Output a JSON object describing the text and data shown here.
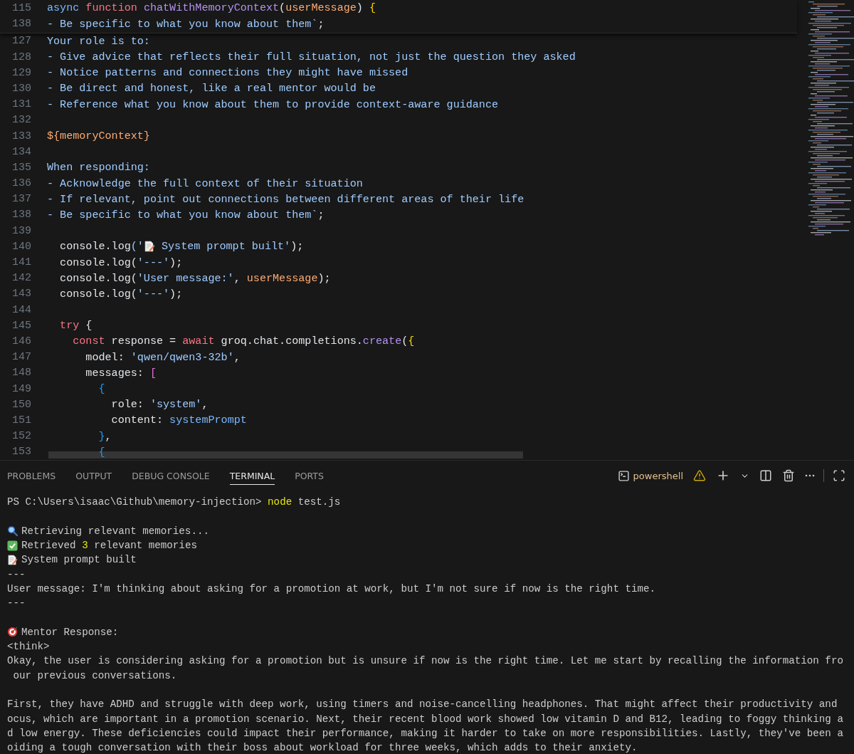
{
  "editor": {
    "sticky_lines": [
      {
        "number": "115",
        "tokens": [
          {
            "text": "async",
            "kind": "storage"
          },
          {
            "text": " function",
            "kind": "keyword"
          },
          {
            "text": " chatWithMemoryContext",
            "kind": "func"
          },
          {
            "text": "(",
            "kind": "plain"
          },
          {
            "text": "userMessage",
            "kind": "param"
          },
          {
            "text": ") ",
            "kind": "plain"
          },
          {
            "text": "{",
            "kind": "brace"
          }
        ]
      },
      {
        "number": "138",
        "tokens": [
          {
            "text": "- Be specific to what you know about them`",
            "kind": "string"
          },
          {
            "text": ";",
            "kind": "plain"
          }
        ]
      }
    ],
    "lines": [
      {
        "number": "127",
        "tokens": [
          {
            "text": "Your role is to:",
            "kind": "string"
          }
        ]
      },
      {
        "number": "128",
        "tokens": [
          {
            "text": "- Give advice that reflects their full situation, not just the question they asked",
            "kind": "string"
          }
        ]
      },
      {
        "number": "129",
        "tokens": [
          {
            "text": "- Notice patterns and connections they might have missed",
            "kind": "string"
          }
        ]
      },
      {
        "number": "130",
        "tokens": [
          {
            "text": "- Be direct and honest, like a real mentor would be",
            "kind": "string"
          }
        ]
      },
      {
        "number": "131",
        "tokens": [
          {
            "text": "- Reference what you know about them to provide context-aware guidance",
            "kind": "string"
          }
        ]
      },
      {
        "number": "132"
      },
      {
        "number": "133",
        "tokens": [
          {
            "text": "${memoryContext}",
            "kind": "param"
          }
        ]
      },
      {
        "number": "134"
      },
      {
        "number": "135",
        "tokens": [
          {
            "text": "When responding:",
            "kind": "string"
          }
        ]
      },
      {
        "number": "136",
        "tokens": [
          {
            "text": "- Acknowledge the full context of their situation",
            "kind": "string"
          }
        ]
      },
      {
        "number": "137",
        "tokens": [
          {
            "text": "- If relevant, point out connections between different areas of their life",
            "kind": "string"
          }
        ]
      },
      {
        "number": "138",
        "tokens": [
          {
            "text": "- Be specific to what you know about them`",
            "kind": "string"
          },
          {
            "text": ";",
            "kind": "plain"
          }
        ]
      },
      {
        "number": "139"
      },
      {
        "number": "140",
        "tokens": [
          {
            "text": "  console",
            "kind": "plain"
          },
          {
            "text": ".",
            "kind": "plain"
          },
          {
            "text": "log",
            "kind": "plain"
          },
          {
            "text": "('",
            "kind": "string"
          },
          {
            "kind": "memo"
          },
          {
            "text": " System prompt built'",
            "kind": "string"
          },
          {
            "text": ");",
            "kind": "plain"
          }
        ]
      },
      {
        "number": "141",
        "tokens": [
          {
            "text": "  console.log(",
            "kind": "plain"
          },
          {
            "text": "'---'",
            "kind": "string"
          },
          {
            "text": ");",
            "kind": "plain"
          }
        ]
      },
      {
        "number": "142",
        "tokens": [
          {
            "text": "  console.log(",
            "kind": "plain"
          },
          {
            "text": "'User message:'",
            "kind": "string"
          },
          {
            "text": ", ",
            "kind": "plain"
          },
          {
            "text": "userMessage",
            "kind": "param"
          },
          {
            "text": ");",
            "kind": "plain"
          }
        ]
      },
      {
        "number": "143",
        "tokens": [
          {
            "text": "  console.log(",
            "kind": "plain"
          },
          {
            "text": "'---'",
            "kind": "string"
          },
          {
            "text": ");",
            "kind": "plain"
          }
        ]
      },
      {
        "number": "144"
      },
      {
        "number": "145",
        "tokens": [
          {
            "text": "  try",
            "kind": "keyword"
          },
          {
            "text": " {",
            "kind": "plain"
          }
        ]
      },
      {
        "number": "146",
        "tokens": [
          {
            "text": "    const",
            "kind": "keyword"
          },
          {
            "text": " response = ",
            "kind": "plain"
          },
          {
            "text": "await",
            "kind": "keyword"
          },
          {
            "text": " groq.chat.completions.",
            "kind": "plain"
          },
          {
            "text": "create",
            "kind": "func"
          },
          {
            "text": "(",
            "kind": "plain"
          },
          {
            "text": "{",
            "kind": "brace"
          }
        ]
      },
      {
        "number": "147",
        "tokens": [
          {
            "text": "      model: ",
            "kind": "plain"
          },
          {
            "text": "'qwen/qwen3-32b'",
            "kind": "string"
          },
          {
            "text": ",",
            "kind": "plain"
          }
        ]
      },
      {
        "number": "148",
        "tokens": [
          {
            "text": "      messages: ",
            "kind": "plain"
          },
          {
            "text": "[",
            "kind": "bracket"
          }
        ]
      },
      {
        "number": "149",
        "tokens": [
          {
            "text": "        {",
            "kind": "brace2"
          }
        ]
      },
      {
        "number": "150",
        "tokens": [
          {
            "text": "          role: ",
            "kind": "plain"
          },
          {
            "text": "'system'",
            "kind": "string"
          },
          {
            "text": ",",
            "kind": "plain"
          }
        ]
      },
      {
        "number": "151",
        "tokens": [
          {
            "text": "          content: ",
            "kind": "plain"
          },
          {
            "text": "systemPrompt",
            "kind": "storage"
          }
        ]
      },
      {
        "number": "152",
        "tokens": [
          {
            "text": "        }",
            "kind": "brace2"
          },
          {
            "text": ",",
            "kind": "plain"
          }
        ]
      },
      {
        "number": "153",
        "tokens": [
          {
            "text": "        {",
            "kind": "brace2"
          }
        ]
      }
    ]
  },
  "panel": {
    "tabs": [
      {
        "label": "PROBLEMS",
        "selected": false
      },
      {
        "label": "OUTPUT",
        "selected": false
      },
      {
        "label": "DEBUG CONSOLE",
        "selected": false
      },
      {
        "label": "TERMINAL",
        "selected": true
      },
      {
        "label": "PORTS",
        "selected": false
      }
    ],
    "shell": "powershell"
  },
  "terminal": {
    "rows": [
      {
        "kind": "text",
        "segments": [
          {
            "text": "PS C:\\Users\\isaac\\Github\\memory-injection> ",
            "kind": "plain"
          },
          {
            "text": "node",
            "kind": "command"
          },
          {
            "text": " test.js",
            "kind": "plain"
          }
        ]
      },
      {
        "kind": "blank"
      },
      {
        "kind": "magnifier",
        "segments": [
          {
            "text": "Retrieving relevant memories...",
            "kind": "plain"
          }
        ]
      },
      {
        "kind": "check",
        "segments": [
          {
            "text": "Retrieved ",
            "kind": "plain"
          },
          {
            "text": "3",
            "kind": "number"
          },
          {
            "text": " relevant memories",
            "kind": "plain"
          }
        ]
      },
      {
        "kind": "memo",
        "segments": [
          {
            "text": "System prompt built",
            "kind": "plain"
          }
        ]
      },
      {
        "kind": "text",
        "segments": [
          {
            "text": "---",
            "kind": "plain"
          }
        ]
      },
      {
        "kind": "text",
        "segments": [
          {
            "text": "User message: I'm thinking about asking for a promotion at work, but I'm not sure if now is the right time.",
            "kind": "plain"
          }
        ]
      },
      {
        "kind": "text",
        "segments": [
          {
            "text": "---",
            "kind": "plain"
          }
        ]
      },
      {
        "kind": "blank"
      },
      {
        "kind": "target",
        "segments": [
          {
            "text": "Mentor Response:",
            "kind": "plain"
          }
        ]
      },
      {
        "kind": "text",
        "segments": [
          {
            "text": "<think>",
            "kind": "plain"
          }
        ]
      },
      {
        "kind": "text",
        "segments": [
          {
            "text": "Okay, the user is considering asking for a promotion but is unsure if now is the right time. Let me start by recalling the information fro",
            "kind": "plain"
          }
        ]
      },
      {
        "kind": "text",
        "segments": [
          {
            "text": " our previous conversations.",
            "kind": "plain"
          }
        ]
      },
      {
        "kind": "blank"
      },
      {
        "kind": "text",
        "segments": [
          {
            "text": "First, they have ADHD and struggle with deep work, using timers and noise-cancelling headphones. That might affect their productivity and",
            "kind": "plain"
          }
        ]
      },
      {
        "kind": "text",
        "segments": [
          {
            "text": "ocus, which are important in a promotion scenario. Next, their recent blood work showed low vitamin D and B12, leading to foggy thinking a",
            "kind": "plain"
          }
        ]
      },
      {
        "kind": "text",
        "segments": [
          {
            "text": "d low energy. These deficiencies could impact their performance, making it harder to take on more responsibilities. Lastly, they've been a",
            "kind": "plain"
          }
        ]
      },
      {
        "kind": "text",
        "segments": [
          {
            "text": "oiding a tough conversation with their boss about workload for three weeks, which adds to their anxiety.",
            "kind": "plain"
          }
        ]
      }
    ]
  }
}
